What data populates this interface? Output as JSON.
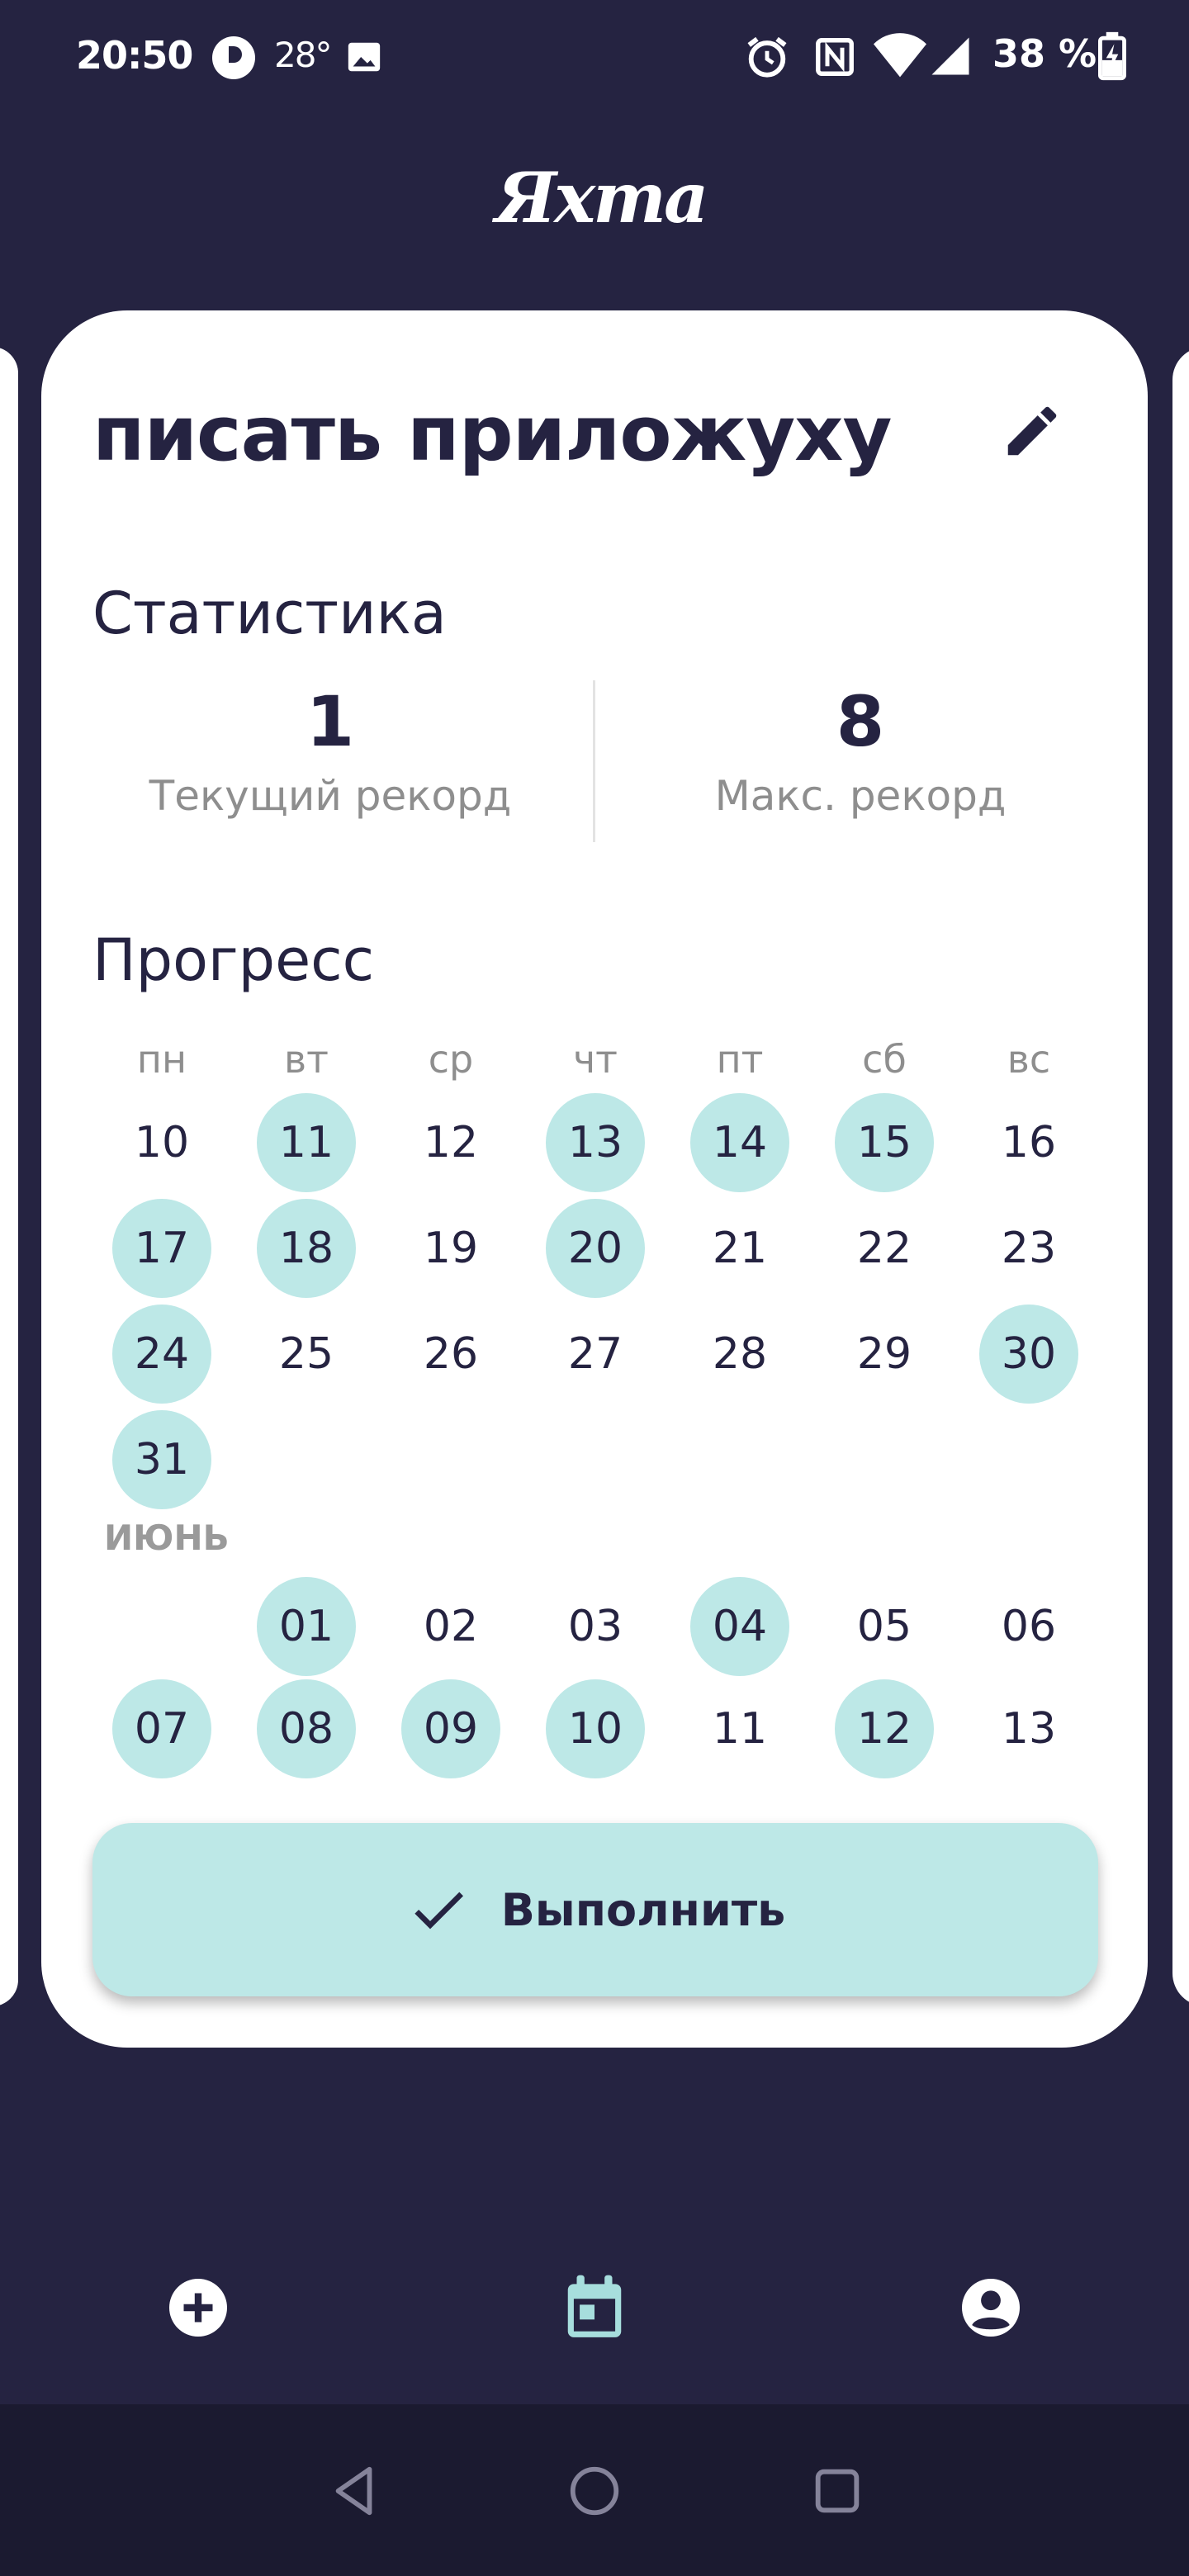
{
  "status_bar": {
    "time": "20:50",
    "temperature": "28°",
    "battery": "38 %",
    "icons": [
      "app-notification-icon",
      "image-icon",
      "alarm-icon",
      "nfc-icon",
      "wifi-icon",
      "signal-icon",
      "battery-charging-icon"
    ]
  },
  "app": {
    "logo_text": "Яхта"
  },
  "habit": {
    "title": "писать приложуху",
    "edit_icon": "pencil-icon"
  },
  "statistics": {
    "heading": "Статистика",
    "current": {
      "value": "1",
      "label": "Текущий рекорд"
    },
    "max": {
      "value": "8",
      "label": "Макс. рекорд"
    }
  },
  "progress": {
    "heading": "Прогресс",
    "weekdays": [
      "пн",
      "вт",
      "ср",
      "чт",
      "пт",
      "сб",
      "вс"
    ],
    "block1_weeks": [
      [
        {
          "d": "10",
          "done": false
        },
        {
          "d": "11",
          "done": true
        },
        {
          "d": "12",
          "done": false
        },
        {
          "d": "13",
          "done": true
        },
        {
          "d": "14",
          "done": true
        },
        {
          "d": "15",
          "done": true
        },
        {
          "d": "16",
          "done": false
        }
      ],
      [
        {
          "d": "17",
          "done": true
        },
        {
          "d": "18",
          "done": true
        },
        {
          "d": "19",
          "done": false
        },
        {
          "d": "20",
          "done": true
        },
        {
          "d": "21",
          "done": false
        },
        {
          "d": "22",
          "done": false
        },
        {
          "d": "23",
          "done": false
        }
      ],
      [
        {
          "d": "24",
          "done": true
        },
        {
          "d": "25",
          "done": false
        },
        {
          "d": "26",
          "done": false
        },
        {
          "d": "27",
          "done": false
        },
        {
          "d": "28",
          "done": false
        },
        {
          "d": "29",
          "done": false
        },
        {
          "d": "30",
          "done": true
        }
      ],
      [
        {
          "d": "31",
          "done": true
        },
        null,
        null,
        null,
        null,
        null,
        null
      ]
    ],
    "month_label": "ИЮНЬ",
    "block2_weeks": [
      [
        null,
        {
          "d": "01",
          "done": true
        },
        {
          "d": "02",
          "done": false
        },
        {
          "d": "03",
          "done": false
        },
        {
          "d": "04",
          "done": true
        },
        {
          "d": "05",
          "done": false
        },
        {
          "d": "06",
          "done": false
        }
      ],
      [
        {
          "d": "07",
          "done": true
        },
        {
          "d": "08",
          "done": true
        },
        {
          "d": "09",
          "done": true
        },
        {
          "d": "10",
          "done": true
        },
        {
          "d": "11",
          "done": false
        },
        {
          "d": "12",
          "done": true
        },
        {
          "d": "13",
          "done": false
        }
      ]
    ]
  },
  "action": {
    "label": "Выполнить",
    "icon": "checkmark-icon"
  },
  "bottom_nav": [
    {
      "name": "add",
      "icon": "add-circle-icon"
    },
    {
      "name": "calendar",
      "icon": "calendar-icon",
      "active": true
    },
    {
      "name": "profile",
      "icon": "account-circle-icon"
    }
  ],
  "system_nav": [
    "back-icon",
    "home-icon",
    "recents-icon"
  ],
  "colors": {
    "background": "#252341",
    "card": "#ffffff",
    "accent": "#bde8e7",
    "text_dark": "#252341",
    "text_muted": "#8e8e8e",
    "nav_active": "#a7dedd",
    "system_bar": "#1b1a30"
  }
}
